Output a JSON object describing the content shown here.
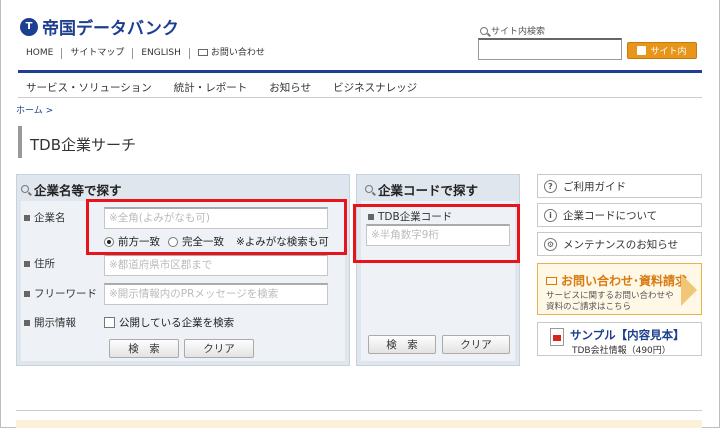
{
  "header": {
    "logo_mark": "T",
    "logo_text": "帝国データバンク",
    "util_links": [
      "HOME",
      "サイトマップ",
      "ENGLISH",
      "お問い合わせ"
    ],
    "site_search_label": "サイト内検索",
    "site_search_button": "サイト内"
  },
  "gnav": [
    "サービス・ソリューション",
    "統計・レポート",
    "お知らせ",
    "ビジネスナレッジ"
  ],
  "breadcrumb": "ホーム >",
  "page_title": "TDB企業サーチ",
  "name_search": {
    "heading": "企業名等で探す",
    "company_label": "企業名",
    "company_placeholder": "※全角(よみがなも可)",
    "radio_prefix": "前方一致",
    "radio_exact": "完全一致",
    "radio_note": "※よみがな検索も可",
    "address_label": "住所",
    "address_placeholder": "※都道府県市区郡まで",
    "freeword_label": "フリーワード",
    "freeword_placeholder": "※開示情報内のPRメッセージを検索",
    "disclosure_label": "開示情報",
    "disclosure_check": "公開している企業を検索",
    "search_button": "検　索",
    "clear_button": "クリア"
  },
  "code_search": {
    "heading": "企業コードで探す",
    "code_label": "TDB企業コード",
    "code_placeholder": "※半角数字9桁",
    "search_button": "検　索",
    "clear_button": "クリア"
  },
  "side": {
    "guide": "ご利用ガイド",
    "about_code": "企業コードについて",
    "maintenance": "メンテナンスのお知らせ",
    "contact_title": "お問い合わせ･資料請求",
    "contact_sub": "サービスに関するお問い合わせや資料のご請求はこちら",
    "sample_title": "サンプル【内容見本】",
    "sample_sub": "TDB会社情報（490円）"
  },
  "colors": {
    "brand": "#1d3f8f",
    "accent": "#e8951c",
    "highlight": "#e8141b"
  }
}
